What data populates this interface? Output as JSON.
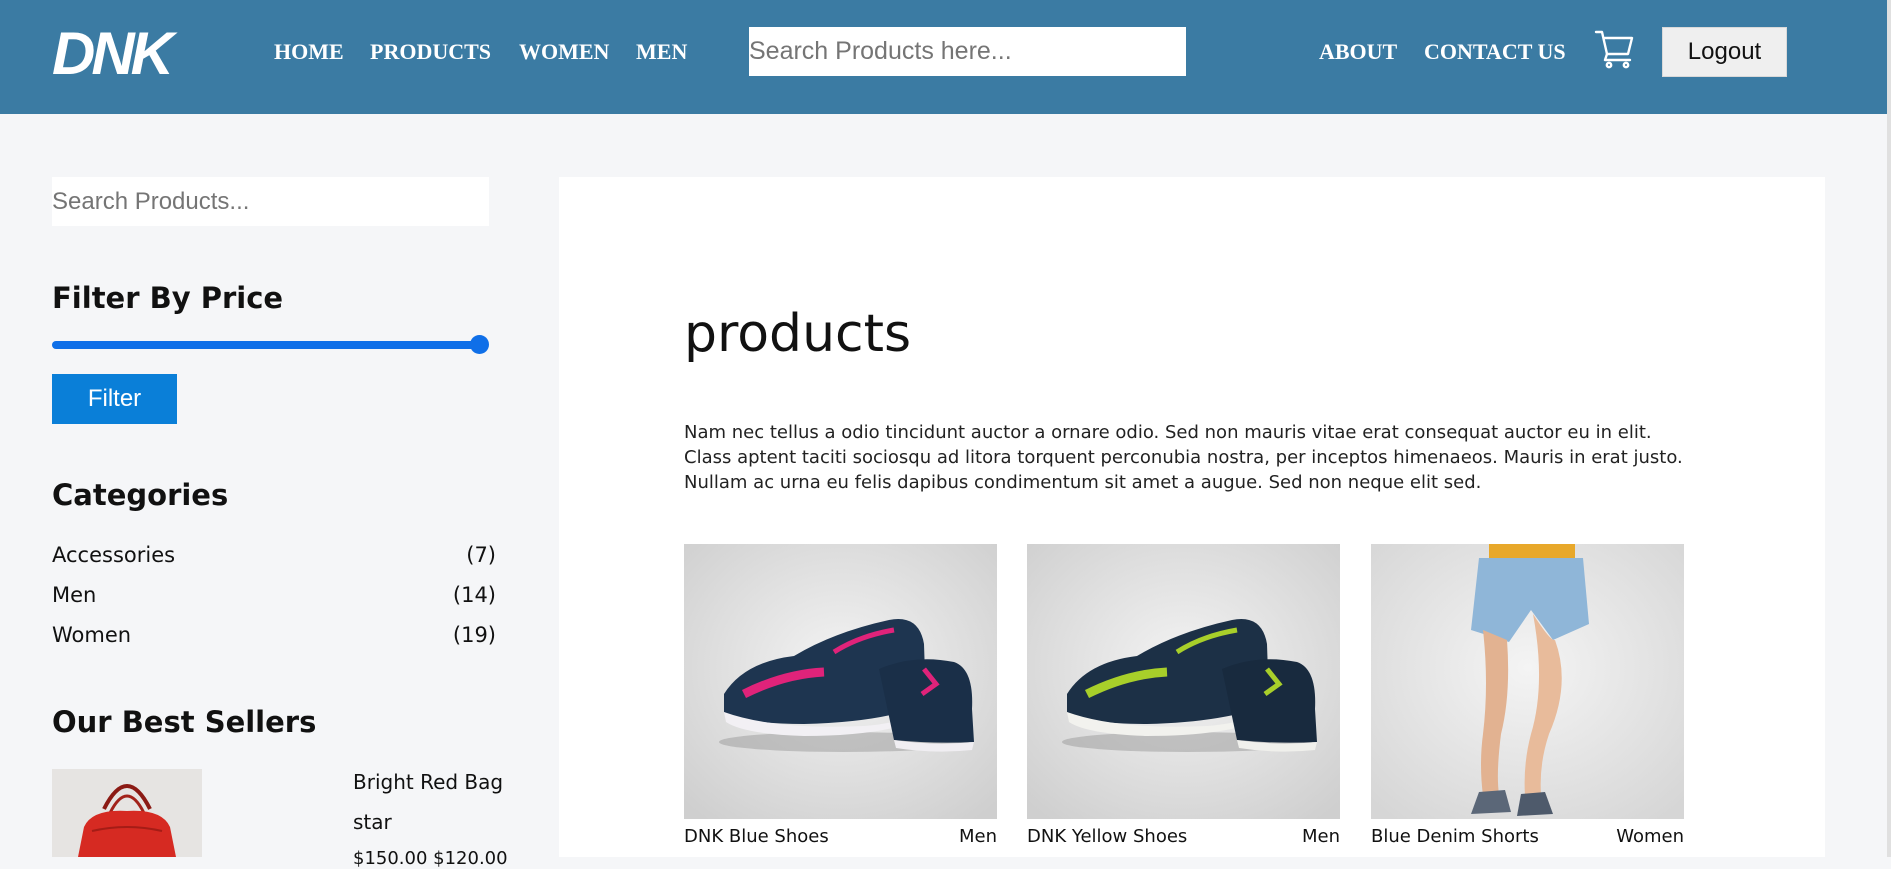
{
  "header": {
    "logo_text": "DNK",
    "nav_left": [
      "HOME",
      "PRODUCTS",
      "WOMEN",
      "MEN"
    ],
    "search_placeholder": "Search Products here...",
    "nav_right": [
      "ABOUT",
      "CONTACT US"
    ],
    "cart_icon": "cart-icon",
    "logout_label": "Logout",
    "bg_color": "#3b7ba3"
  },
  "sidebar": {
    "search_placeholder": "Search Products...",
    "filter_heading": "Filter By Price",
    "price_slider_level": 1.0,
    "filter_button": "Filter",
    "categories_heading": "Categories",
    "categories": [
      {
        "name": "Accessories",
        "count": "(7)"
      },
      {
        "name": "Men",
        "count": "(14)"
      },
      {
        "name": "Women",
        "count": "(19)"
      }
    ],
    "best_sellers_heading": "Our Best Sellers",
    "best_seller": {
      "name": "Bright Red Bag",
      "rating": "star",
      "price": "$150.00 $120.00"
    }
  },
  "main": {
    "title": "products",
    "intro": "Nam nec tellus a odio tincidunt auctor a ornare odio. Sed non mauris vitae erat consequat auctor eu in elit. Class aptent taciti sociosqu ad litora torquent perconubia nostra, per inceptos himenaeos. Mauris in erat justo. Nullam ac urna eu felis dapibus condimentum sit amet a augue. Sed non neque elit sed.",
    "products": [
      {
        "name": "DNK Blue Shoes",
        "category": "Men",
        "accent": "#e0237a"
      },
      {
        "name": "DNK Yellow Shoes",
        "category": "Men",
        "accent": "#a8cf2a"
      },
      {
        "name": "Blue Denim Shorts",
        "category": "Women",
        "accent": "#8fb6d8"
      }
    ]
  },
  "colors": {
    "accent_blue": "#0a7fd8",
    "page_bg": "#f5f6f8"
  }
}
